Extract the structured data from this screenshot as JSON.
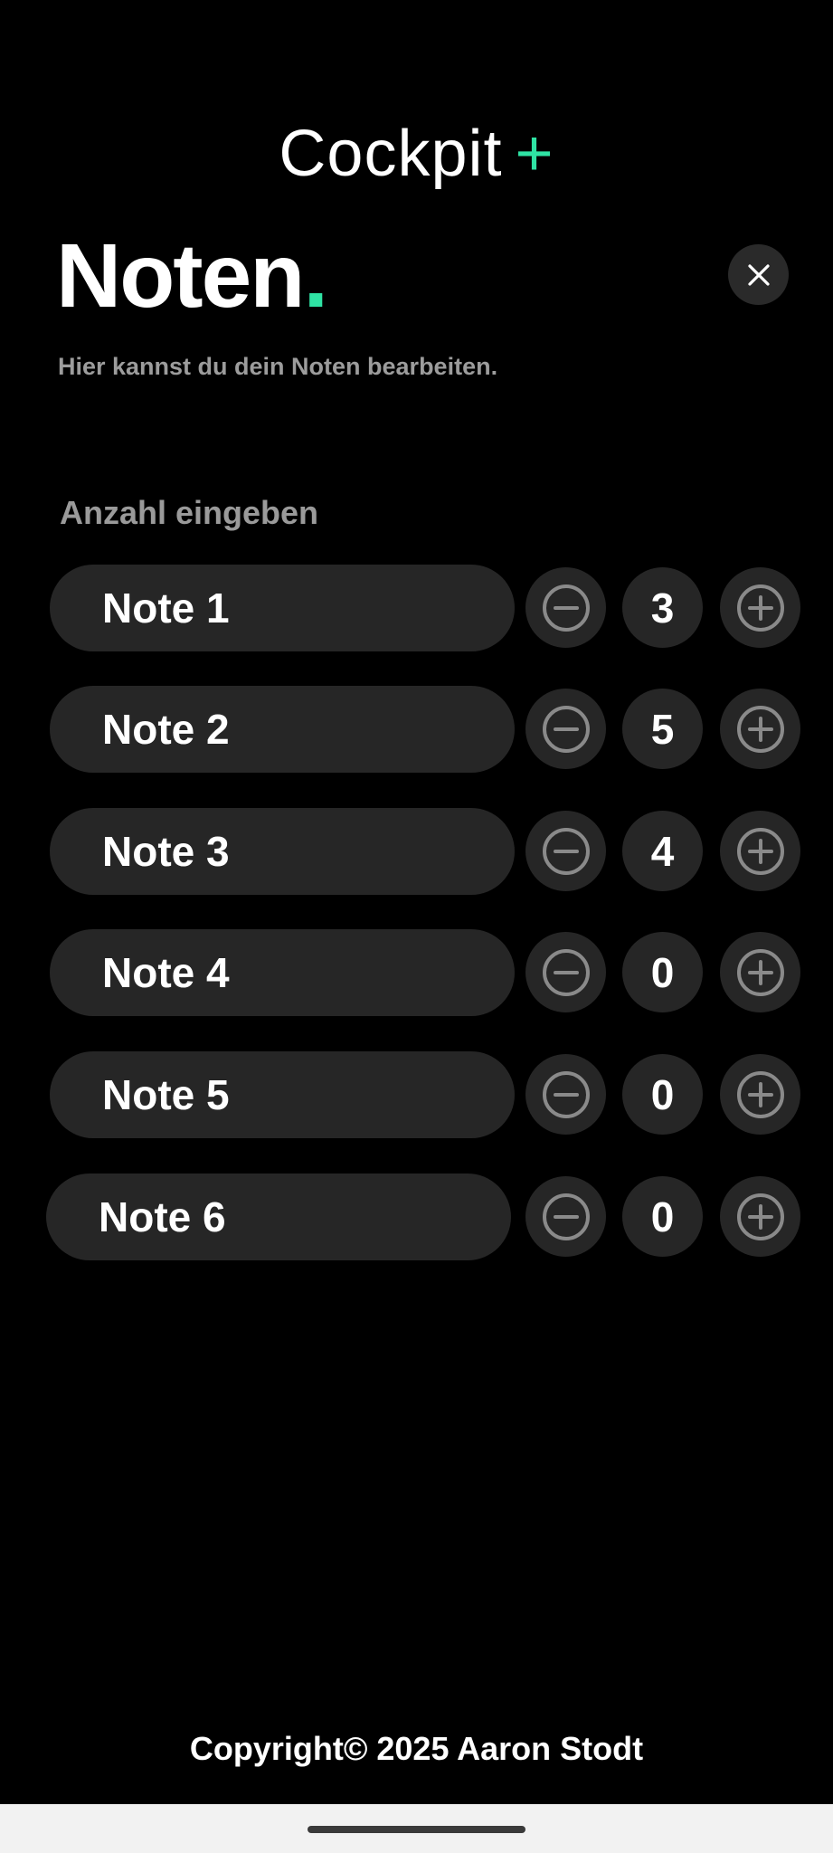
{
  "brand": {
    "name": "Cockpit",
    "plus": "+"
  },
  "header": {
    "title": "Noten",
    "title_dot": ".",
    "subtitle": "Hier kannst du dein Noten bearbeiten."
  },
  "section": {
    "label": "Anzahl eingeben"
  },
  "notes": [
    {
      "label": "Note 1",
      "count": "3"
    },
    {
      "label": "Note 2",
      "count": "5"
    },
    {
      "label": "Note 3",
      "count": "4"
    },
    {
      "label": "Note 4",
      "count": "0"
    },
    {
      "label": "Note 5",
      "count": "0"
    },
    {
      "label": "Note 6",
      "count": "0"
    }
  ],
  "footer": {
    "copyright": "Copyright© 2025 Aaron Stodt"
  },
  "icons": {
    "close": "close-icon",
    "minus": "minus-circle-icon",
    "plus": "plus-circle-icon"
  },
  "colors": {
    "accent": "#2fe3a4",
    "background": "#000000",
    "surface": "#262626",
    "muted": "#9c9c9c"
  }
}
